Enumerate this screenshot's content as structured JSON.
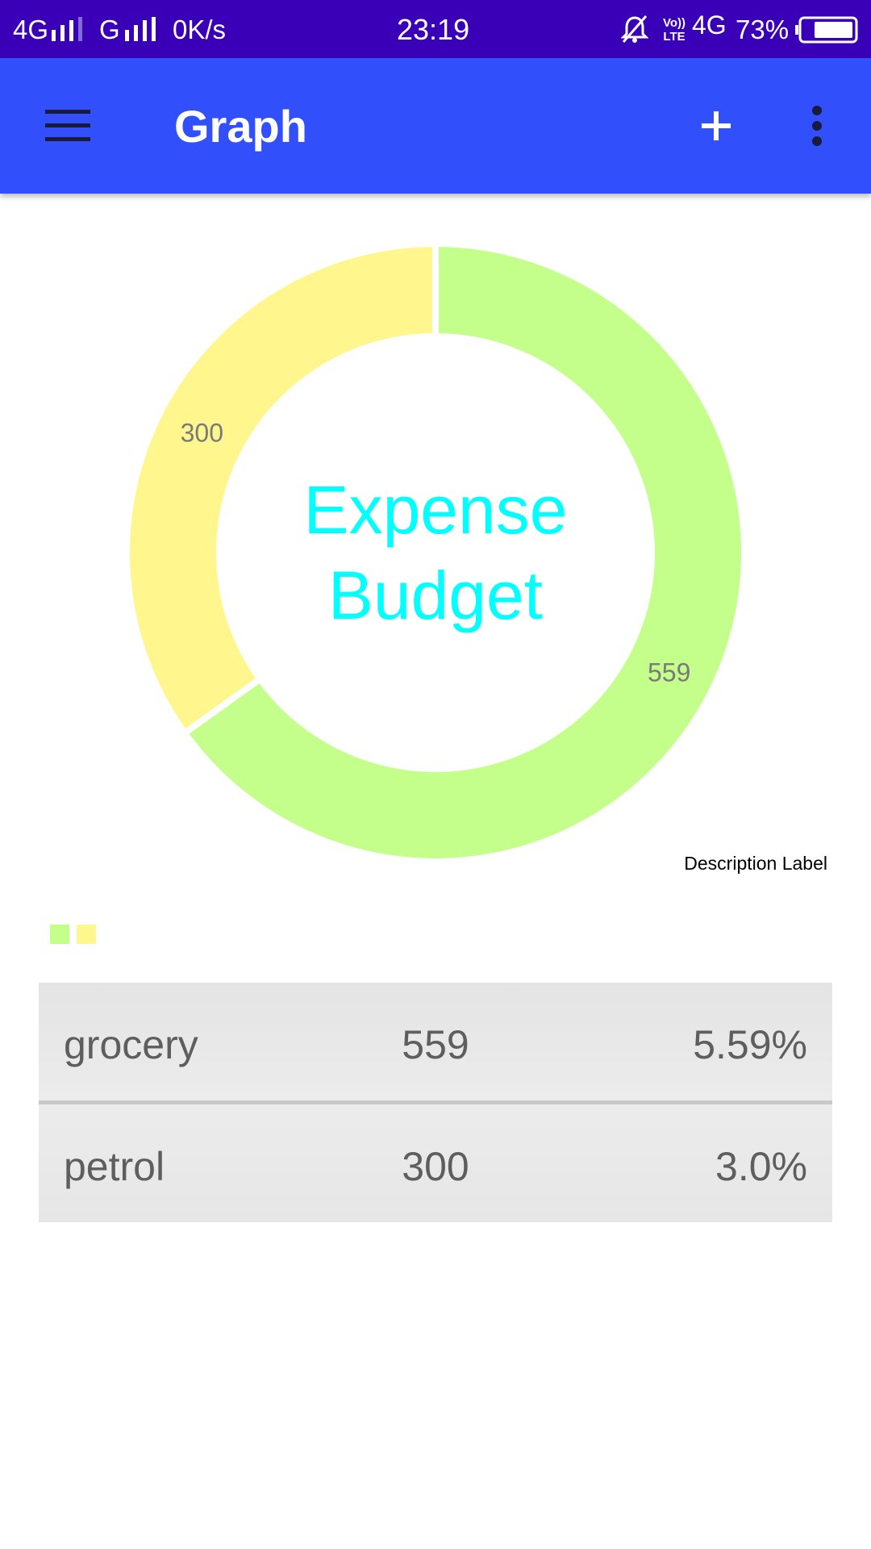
{
  "status_bar": {
    "network_left": "4G",
    "network_mid": "G",
    "speed": "0K/s",
    "time": "23:19",
    "volte": "Vo)) LTE",
    "network_right": "4G",
    "battery": "73%"
  },
  "app_bar": {
    "title": "Graph",
    "icons": [
      "menu-icon",
      "add-icon",
      "more-vert-icon"
    ]
  },
  "chart_data": {
    "type": "pie",
    "variant": "donut",
    "center_text": [
      "Expense",
      "Budget"
    ],
    "description": "Description Label",
    "slices": [
      {
        "label": "grocery",
        "value": 559,
        "color": "#c3ff8a"
      },
      {
        "label": "petrol",
        "value": 300,
        "color": "#fff68e"
      }
    ],
    "center_color": "#00ffff",
    "value_label_color": "#7a7a7a"
  },
  "table": {
    "rows": [
      {
        "name": "grocery",
        "value": "559",
        "percent": "5.59%"
      },
      {
        "name": "petrol",
        "value": "300",
        "percent": "3.0%"
      }
    ]
  },
  "colors": {
    "status_bar": "#3a00b8",
    "app_bar": "#314ffb"
  }
}
